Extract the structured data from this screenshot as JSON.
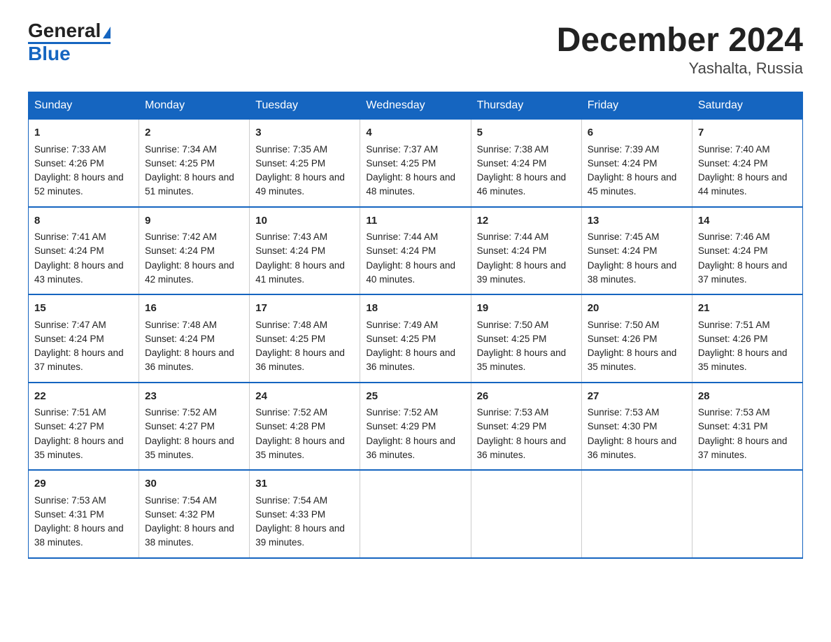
{
  "header": {
    "logo_general": "General",
    "logo_blue": "Blue",
    "month_title": "December 2024",
    "location": "Yashalta, Russia"
  },
  "weekdays": [
    "Sunday",
    "Monday",
    "Tuesday",
    "Wednesday",
    "Thursday",
    "Friday",
    "Saturday"
  ],
  "weeks": [
    [
      {
        "day": "1",
        "sunrise": "7:33 AM",
        "sunset": "4:26 PM",
        "daylight": "8 hours and 52 minutes."
      },
      {
        "day": "2",
        "sunrise": "7:34 AM",
        "sunset": "4:25 PM",
        "daylight": "8 hours and 51 minutes."
      },
      {
        "day": "3",
        "sunrise": "7:35 AM",
        "sunset": "4:25 PM",
        "daylight": "8 hours and 49 minutes."
      },
      {
        "day": "4",
        "sunrise": "7:37 AM",
        "sunset": "4:25 PM",
        "daylight": "8 hours and 48 minutes."
      },
      {
        "day": "5",
        "sunrise": "7:38 AM",
        "sunset": "4:24 PM",
        "daylight": "8 hours and 46 minutes."
      },
      {
        "day": "6",
        "sunrise": "7:39 AM",
        "sunset": "4:24 PM",
        "daylight": "8 hours and 45 minutes."
      },
      {
        "day": "7",
        "sunrise": "7:40 AM",
        "sunset": "4:24 PM",
        "daylight": "8 hours and 44 minutes."
      }
    ],
    [
      {
        "day": "8",
        "sunrise": "7:41 AM",
        "sunset": "4:24 PM",
        "daylight": "8 hours and 43 minutes."
      },
      {
        "day": "9",
        "sunrise": "7:42 AM",
        "sunset": "4:24 PM",
        "daylight": "8 hours and 42 minutes."
      },
      {
        "day": "10",
        "sunrise": "7:43 AM",
        "sunset": "4:24 PM",
        "daylight": "8 hours and 41 minutes."
      },
      {
        "day": "11",
        "sunrise": "7:44 AM",
        "sunset": "4:24 PM",
        "daylight": "8 hours and 40 minutes."
      },
      {
        "day": "12",
        "sunrise": "7:44 AM",
        "sunset": "4:24 PM",
        "daylight": "8 hours and 39 minutes."
      },
      {
        "day": "13",
        "sunrise": "7:45 AM",
        "sunset": "4:24 PM",
        "daylight": "8 hours and 38 minutes."
      },
      {
        "day": "14",
        "sunrise": "7:46 AM",
        "sunset": "4:24 PM",
        "daylight": "8 hours and 37 minutes."
      }
    ],
    [
      {
        "day": "15",
        "sunrise": "7:47 AM",
        "sunset": "4:24 PM",
        "daylight": "8 hours and 37 minutes."
      },
      {
        "day": "16",
        "sunrise": "7:48 AM",
        "sunset": "4:24 PM",
        "daylight": "8 hours and 36 minutes."
      },
      {
        "day": "17",
        "sunrise": "7:48 AM",
        "sunset": "4:25 PM",
        "daylight": "8 hours and 36 minutes."
      },
      {
        "day": "18",
        "sunrise": "7:49 AM",
        "sunset": "4:25 PM",
        "daylight": "8 hours and 36 minutes."
      },
      {
        "day": "19",
        "sunrise": "7:50 AM",
        "sunset": "4:25 PM",
        "daylight": "8 hours and 35 minutes."
      },
      {
        "day": "20",
        "sunrise": "7:50 AM",
        "sunset": "4:26 PM",
        "daylight": "8 hours and 35 minutes."
      },
      {
        "day": "21",
        "sunrise": "7:51 AM",
        "sunset": "4:26 PM",
        "daylight": "8 hours and 35 minutes."
      }
    ],
    [
      {
        "day": "22",
        "sunrise": "7:51 AM",
        "sunset": "4:27 PM",
        "daylight": "8 hours and 35 minutes."
      },
      {
        "day": "23",
        "sunrise": "7:52 AM",
        "sunset": "4:27 PM",
        "daylight": "8 hours and 35 minutes."
      },
      {
        "day": "24",
        "sunrise": "7:52 AM",
        "sunset": "4:28 PM",
        "daylight": "8 hours and 35 minutes."
      },
      {
        "day": "25",
        "sunrise": "7:52 AM",
        "sunset": "4:29 PM",
        "daylight": "8 hours and 36 minutes."
      },
      {
        "day": "26",
        "sunrise": "7:53 AM",
        "sunset": "4:29 PM",
        "daylight": "8 hours and 36 minutes."
      },
      {
        "day": "27",
        "sunrise": "7:53 AM",
        "sunset": "4:30 PM",
        "daylight": "8 hours and 36 minutes."
      },
      {
        "day": "28",
        "sunrise": "7:53 AM",
        "sunset": "4:31 PM",
        "daylight": "8 hours and 37 minutes."
      }
    ],
    [
      {
        "day": "29",
        "sunrise": "7:53 AM",
        "sunset": "4:31 PM",
        "daylight": "8 hours and 38 minutes."
      },
      {
        "day": "30",
        "sunrise": "7:54 AM",
        "sunset": "4:32 PM",
        "daylight": "8 hours and 38 minutes."
      },
      {
        "day": "31",
        "sunrise": "7:54 AM",
        "sunset": "4:33 PM",
        "daylight": "8 hours and 39 minutes."
      },
      null,
      null,
      null,
      null
    ]
  ]
}
